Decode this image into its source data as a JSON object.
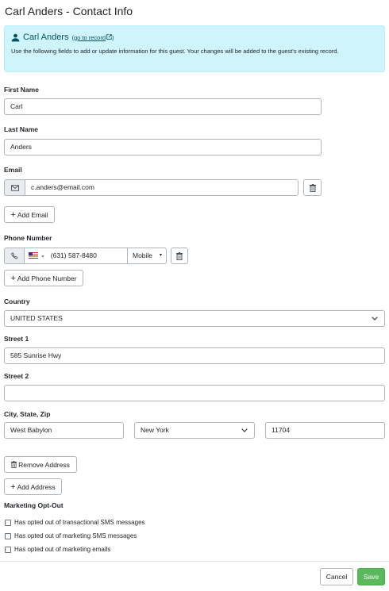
{
  "page": {
    "title": "Carl Anders - Contact Info"
  },
  "info": {
    "name": "Carl Anders",
    "link_open": "(",
    "link_text": "go to record",
    "link_close": ")",
    "description": "Use the following fields to add or update information for this guest. Your changes will be added to the guest's existing record."
  },
  "fields": {
    "first_name_label": "First Name",
    "first_name": "Carl",
    "last_name_label": "Last Name",
    "last_name": "Anders",
    "email_label": "Email",
    "email": "c.anders@email.com",
    "add_email": "Add Email",
    "phone_label": "Phone Number",
    "phone_flag_caret": "▾",
    "phone": "(631) 587-8480",
    "phone_type": "Mobile",
    "add_phone": "Add Phone Number",
    "country_label": "Country",
    "country": "UNITED STATES",
    "street1_label": "Street 1",
    "street1": "585 Sunrise Hwy",
    "street2_label": "Street 2",
    "street2": "",
    "csz_label": "City, State, Zip",
    "city": "West Babylon",
    "state": "New York",
    "zip": "11704",
    "remove_address": "Remove Address",
    "add_address": "Add Address"
  },
  "marketing": {
    "label": "Marketing Opt-Out",
    "options": [
      "Has opted out of transactional SMS messages",
      "Has opted out of marketing SMS messages",
      "Has opted out of marketing emails"
    ]
  },
  "footer": {
    "cancel": "Cancel",
    "save": "Save"
  },
  "colors": {
    "info_bg": "#cff4fc",
    "save_green": "#5cb85c"
  }
}
